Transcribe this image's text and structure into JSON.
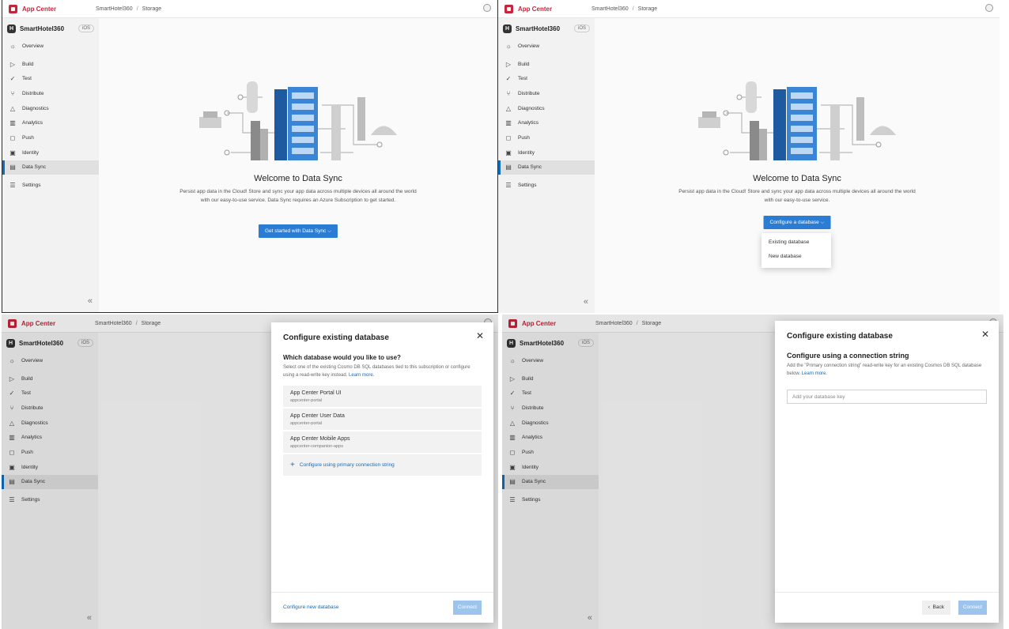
{
  "header": {
    "app_name": "App Center",
    "breadcrumb": [
      "SmartHotel360",
      "Storage"
    ],
    "separator": "/"
  },
  "sidebar": {
    "app_title": "SmartHotel360",
    "platform": "iOS",
    "items": [
      {
        "label": "Overview",
        "icon": "overview-icon"
      },
      {
        "label": "Build",
        "icon": "build-icon"
      },
      {
        "label": "Test",
        "icon": "test-icon"
      },
      {
        "label": "Distribute",
        "icon": "distribute-icon"
      },
      {
        "label": "Diagnostics",
        "icon": "diagnostics-icon"
      },
      {
        "label": "Analytics",
        "icon": "analytics-icon"
      },
      {
        "label": "Push",
        "icon": "push-icon"
      },
      {
        "label": "Identity",
        "icon": "identity-icon"
      },
      {
        "label": "Data Sync",
        "icon": "data-sync-icon",
        "active": true
      },
      {
        "label": "Settings",
        "icon": "settings-icon"
      }
    ]
  },
  "welcome": {
    "title": "Welcome to Data Sync",
    "description_full": "Persist app data in the Cloud! Store and sync your app data across multiple devices all around the world with our easy-to-use service. Data Sync requires an Azure Subscription to get started.",
    "description_short": "Persist app data in the Cloud! Store and sync your app data across multiple devices all around the world with our easy-to-use service.",
    "get_started_label": "Get started with Data Sync",
    "configure_label": "Configure a database",
    "dropdown_options": [
      "Existing database",
      "New database"
    ]
  },
  "existing_modal": {
    "title": "Configure existing database",
    "question": "Which database would you like to use?",
    "subtitle": "Select one of the existing Cosmo DB SQL databases tied to this subscription or configure using a read-write key instead.",
    "learn_more": "Learn more.",
    "databases": [
      {
        "name": "App Center Portal UI",
        "id": "appcenter-portal"
      },
      {
        "name": "App Center User Data",
        "id": "appcenter-portal"
      },
      {
        "name": "App Center Mobile Apps",
        "id": "appcenter-companion-apps"
      }
    ],
    "connection_string_option": "Configure using primary connection string",
    "footer_link": "Configure new database",
    "connect_label": "Connect"
  },
  "connection_modal": {
    "title": "Configure existing database",
    "heading": "Configure using a connection string",
    "subtitle": "Add the \"Primary connection string\" read-write key for an existing Cosmos DB SQL database below.",
    "learn_more": "Learn more.",
    "input_placeholder": "Add your database key",
    "back_label": "Back",
    "connect_label": "Connect"
  },
  "colors": {
    "brand": "#c8253b",
    "accent": "#2b7cd3",
    "disabled_button": "#9dc4ec",
    "link": "#0f6cbd"
  }
}
